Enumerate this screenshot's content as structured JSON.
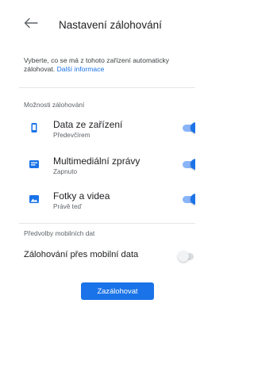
{
  "header": {
    "title": "Nastavení zálohování"
  },
  "intro": {
    "line1": "Vyberte, co se má z tohoto zařízení automaticky",
    "line2_prefix": "zálohovat.",
    "link": "Další informace"
  },
  "options": {
    "section_label": "Možnosti zálohování",
    "items": [
      {
        "label": "Data ze zařízení",
        "sub": "Předevčírem",
        "icon": "phone-icon",
        "enabled": true
      },
      {
        "label": "Multimediální zprávy",
        "sub": "Zapnuto",
        "icon": "message-icon",
        "enabled": true
      },
      {
        "label": "Fotky a videa",
        "sub": "Právě teď",
        "icon": "photo-icon",
        "enabled": true
      }
    ]
  },
  "mobile": {
    "section_label": "Předvolby mobilních dat",
    "label": "Zálohování přes mobilní data",
    "enabled": false
  },
  "actions": {
    "backup_label": "Zazálohovat"
  },
  "colors": {
    "accent": "#1a73e8",
    "accent_track": "#8ab4f8",
    "off_track": "#dadce0",
    "text": "#202124",
    "secondary": "#5f6368"
  }
}
